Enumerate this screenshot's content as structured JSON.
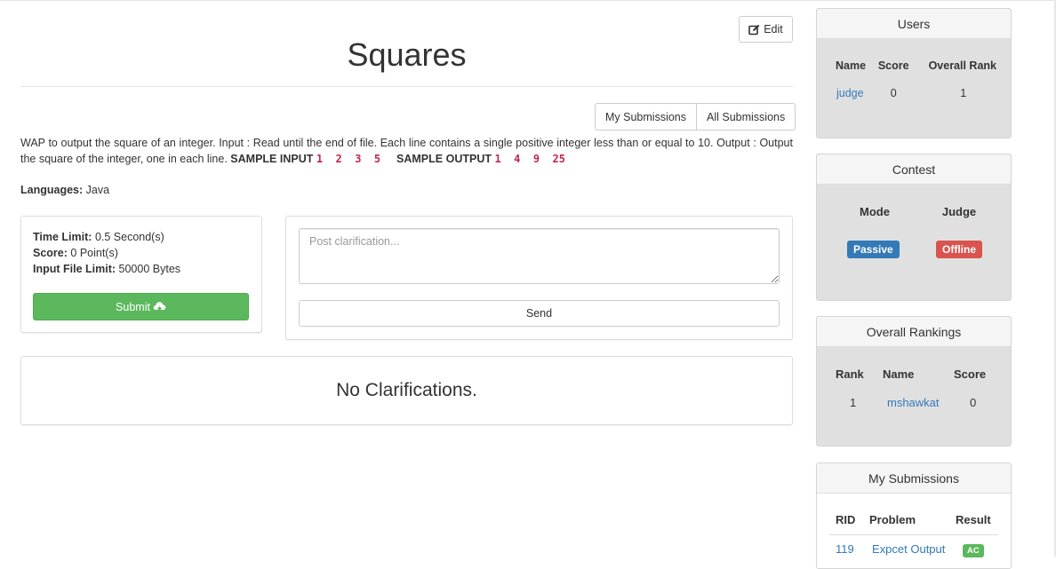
{
  "problem": {
    "title": "Squares",
    "edit_label": "Edit",
    "my_submissions_label": "My Submissions",
    "all_submissions_label": "All Submissions",
    "description": "WAP to output the square of an integer. Input : Read until the end of file. Each line contains a single positive integer less than or equal to 10. Output : Output the square of the integer, one in each line.",
    "sample_input_label": "SAMPLE INPUT",
    "sample_input": "1 2 3 5",
    "sample_output_label": "SAMPLE OUTPUT",
    "sample_output": "1 4 9 25",
    "languages_label": "Languages:",
    "languages_value": "Java"
  },
  "limits": {
    "time_label": "Time Limit:",
    "time_value": "0.5 Second(s)",
    "score_label": "Score:",
    "score_value": "0 Point(s)",
    "input_label": "Input File Limit:",
    "input_value": "50000 Bytes",
    "submit_label": "Submit"
  },
  "clarification": {
    "placeholder": "Post clarification...",
    "send_label": "Send",
    "empty_message": "No Clarifications."
  },
  "users": {
    "heading": "Users",
    "columns": [
      "Name",
      "Score",
      "Overall Rank"
    ],
    "rows": [
      {
        "name": "judge",
        "score": "0",
        "rank": "1"
      }
    ]
  },
  "contest": {
    "heading": "Contest",
    "mode_label": "Mode",
    "judge_label": "Judge",
    "mode_value": "Passive",
    "judge_value": "Offline"
  },
  "overall_rankings": {
    "heading": "Overall Rankings",
    "columns": [
      "Rank",
      "Name",
      "Score"
    ],
    "rows": [
      {
        "rank": "1",
        "name": "mshawkat",
        "score": "0"
      }
    ]
  },
  "my_submissions": {
    "heading": "My Submissions",
    "columns": [
      "RID",
      "Problem",
      "Result"
    ],
    "rows": [
      {
        "rid": "119",
        "problem": "Expcet Output",
        "result": "AC"
      }
    ]
  },
  "colors": {
    "link": "#337ab7",
    "success": "#5cb85c",
    "primary": "#337ab7",
    "danger": "#d9534f",
    "sample_code": "#c7254e"
  },
  "icons": {
    "edit": "edit-icon",
    "submit": "cloud-upload-icon"
  }
}
